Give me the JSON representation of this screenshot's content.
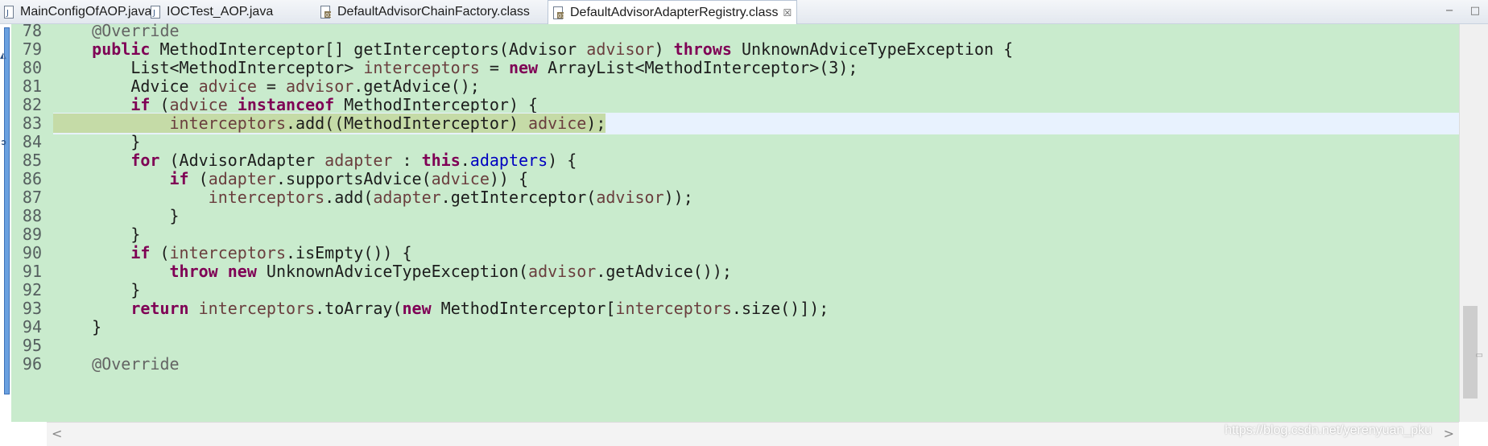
{
  "tabs": [
    {
      "label": "MainConfigOfAOP.java",
      "icon": "java-file-icon"
    },
    {
      "label": "IOCTest_AOP.java",
      "icon": "java-file-icon"
    },
    {
      "label": "DefaultAdvisorChainFactory.class",
      "icon": "class-file-icon"
    },
    {
      "label": "DefaultAdvisorAdapterRegistry.class",
      "icon": "class-file-icon",
      "active": true,
      "close_glyph": "☒"
    }
  ],
  "window_controls": {
    "minimize": "−",
    "maximize": "□"
  },
  "editor": {
    "current_line": 83,
    "lines": [
      {
        "num": "78",
        "code": "    @Override"
      },
      {
        "num": "79",
        "code": "    public MethodInterceptor[] getInterceptors(Advisor advisor) throws UnknownAdviceTypeException {"
      },
      {
        "num": "80",
        "code": "        List<MethodInterceptor> interceptors = new ArrayList<MethodInterceptor>(3);"
      },
      {
        "num": "81",
        "code": "        Advice advice = advisor.getAdvice();"
      },
      {
        "num": "82",
        "code": "        if (advice instanceof MethodInterceptor) {"
      },
      {
        "num": "83",
        "code": "            interceptors.add((MethodInterceptor) advice);"
      },
      {
        "num": "84",
        "code": "        }"
      },
      {
        "num": "85",
        "code": "        for (AdvisorAdapter adapter : this.adapters) {"
      },
      {
        "num": "86",
        "code": "            if (adapter.supportsAdvice(advice)) {"
      },
      {
        "num": "87",
        "code": "                interceptors.add(adapter.getInterceptor(advisor));"
      },
      {
        "num": "88",
        "code": "            }"
      },
      {
        "num": "89",
        "code": "        }"
      },
      {
        "num": "90",
        "code": "        if (interceptors.isEmpty()) {"
      },
      {
        "num": "91",
        "code": "            throw new UnknownAdviceTypeException(advisor.getAdvice());"
      },
      {
        "num": "92",
        "code": "        }"
      },
      {
        "num": "93",
        "code": "        return interceptors.toArray(new MethodInterceptor[interceptors.size()]);"
      },
      {
        "num": "94",
        "code": "    }"
      },
      {
        "num": "95",
        "code": ""
      },
      {
        "num": "96",
        "code": "    @Override"
      }
    ]
  },
  "scrollbar": {
    "left_arrow": "<",
    "right_arrow": ">"
  },
  "watermark": "https://blog.csdn.net/yerenyuan_pku",
  "colors": {
    "editor_bg": "#c9ebcd",
    "current_line_bg": "#e8f2fe",
    "execution_highlight": "#c5dba7",
    "keyword": "#7f0055",
    "variable": "#6a3e3e",
    "field": "#0000c0"
  }
}
